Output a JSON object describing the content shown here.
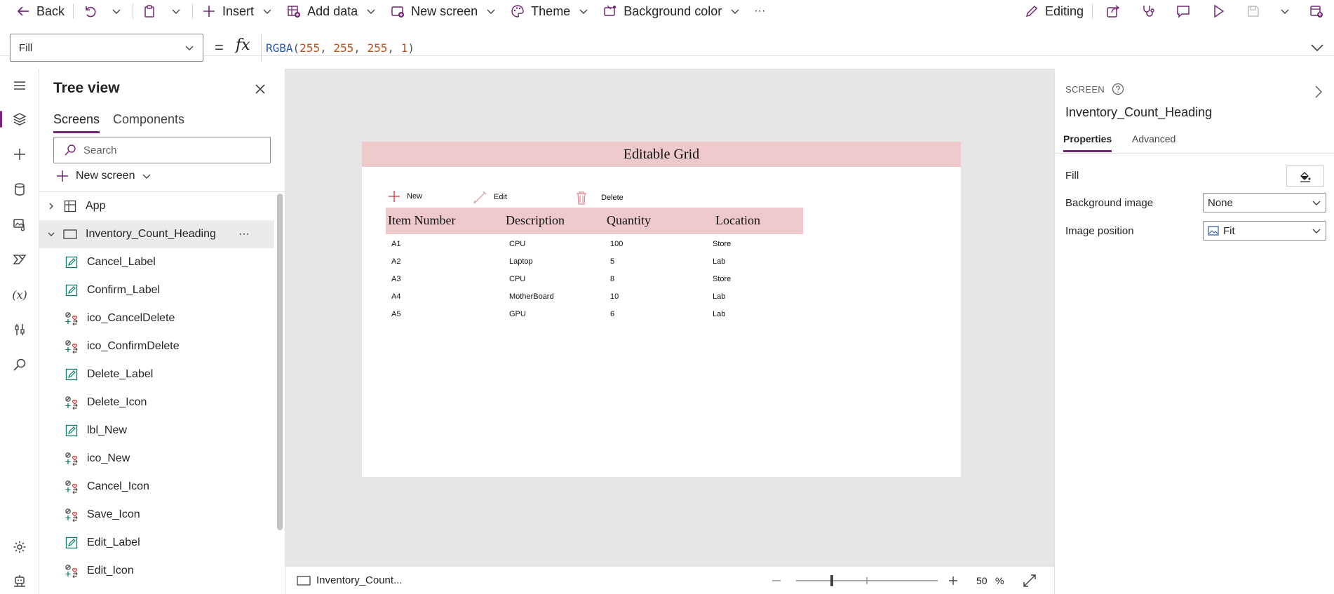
{
  "toolbar": {
    "back": "Back",
    "insert": "Insert",
    "add_data": "Add data",
    "new_screen": "New screen",
    "theme": "Theme",
    "background_color": "Background color",
    "more": "···",
    "editing": "Editing"
  },
  "formula": {
    "property": "Fill",
    "equals": "=",
    "fx": "fx",
    "fn_name": "RGBA",
    "args": [
      "255",
      "255",
      "255",
      "1"
    ]
  },
  "tree": {
    "title": "Tree view",
    "tabs": [
      "Screens",
      "Components"
    ],
    "search_placeholder": "Search",
    "new_screen": "New screen",
    "app_label": "App",
    "screen_label": "Inventory_Count_Heading",
    "screen_more": "···",
    "items": [
      {
        "label": "Cancel_Label",
        "icon": "label-icon"
      },
      {
        "label": "Confirm_Label",
        "icon": "label-icon"
      },
      {
        "label": "ico_CancelDelete",
        "icon": "icon-control-icon"
      },
      {
        "label": "ico_ConfirmDelete",
        "icon": "icon-control-icon"
      },
      {
        "label": "Delete_Label",
        "icon": "label-icon"
      },
      {
        "label": "Delete_Icon",
        "icon": "icon-control-icon"
      },
      {
        "label": "lbl_New",
        "icon": "label-icon"
      },
      {
        "label": "ico_New",
        "icon": "icon-control-icon"
      },
      {
        "label": "Cancel_Icon",
        "icon": "icon-control-icon"
      },
      {
        "label": "Save_Icon",
        "icon": "icon-control-icon"
      },
      {
        "label": "Edit_Label",
        "icon": "label-icon"
      },
      {
        "label": "Edit_Icon",
        "icon": "icon-control-icon"
      }
    ]
  },
  "canvas": {
    "grid_title": "Editable Grid",
    "actions": {
      "new": "New",
      "edit": "Edit",
      "delete": "Delete"
    },
    "columns": [
      "Item Number",
      "Description",
      "Quantity",
      "Location"
    ],
    "rows": [
      [
        "A1",
        "CPU",
        "100",
        "Store"
      ],
      [
        "A2",
        "Laptop",
        "5",
        "Lab"
      ],
      [
        "A3",
        "CPU",
        "8",
        "Store"
      ],
      [
        "A4",
        "MotherBoard",
        "10",
        "Lab"
      ],
      [
        "A5",
        "GPU",
        "6",
        "Lab"
      ]
    ]
  },
  "status": {
    "screen_crumb": "Inventory_Count...",
    "zoom_value": "50",
    "zoom_unit": "%",
    "zoom_level": 0.5
  },
  "properties": {
    "kind": "SCREEN",
    "name": "Inventory_Count_Heading",
    "tabs": [
      "Properties",
      "Advanced"
    ],
    "fill_label": "Fill",
    "bg_image_label": "Background image",
    "bg_image_value": "None",
    "img_position_label": "Image position",
    "img_position_value": "Fit"
  },
  "colors": {
    "accent": "#742774",
    "header_pink": "#edc9cb",
    "canvas_bg": "#e6e6e6",
    "icon_red": "#d13438"
  }
}
